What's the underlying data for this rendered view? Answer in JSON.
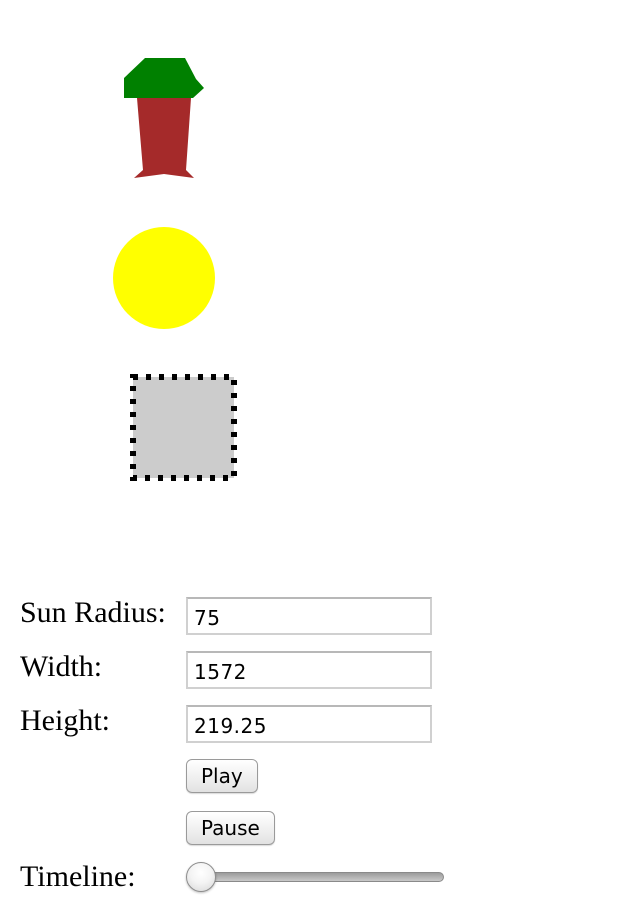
{
  "scene": {
    "tree": {
      "trunk_color": "#a52a2a",
      "crown_color": "#008000"
    },
    "sun": {
      "color": "#ffff00"
    },
    "house": {
      "fill_color": "#cccccc",
      "border_color": "#000000",
      "border_style": "dashed"
    }
  },
  "form": {
    "sun_radius": {
      "label": "Sun Radius:",
      "value": "75"
    },
    "width": {
      "label": "Width:",
      "value": "1572"
    },
    "height": {
      "label": "Height:",
      "value": "219.25"
    },
    "play_label": "Play",
    "pause_label": "Pause",
    "timeline": {
      "label": "Timeline:",
      "value": 0
    }
  }
}
